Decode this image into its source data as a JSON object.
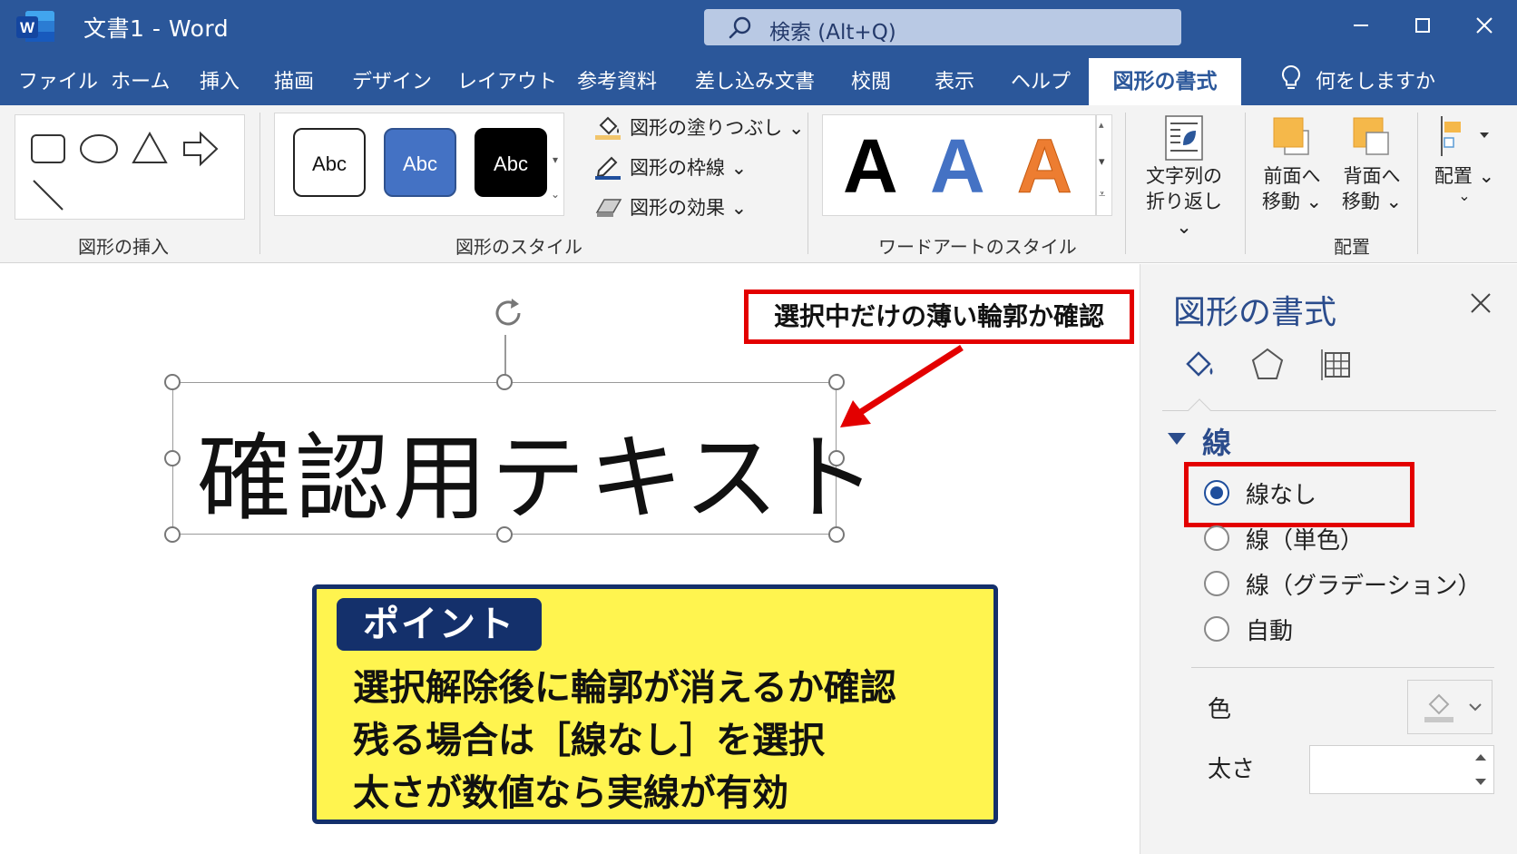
{
  "window": {
    "title": "文書1  -  Word",
    "search_placeholder": "検索 (Alt+Q)"
  },
  "menu": {
    "tabs": [
      "ファイル",
      "ホーム",
      "挿入",
      "描画",
      "デザイン",
      "レイアウト",
      "参考資料",
      "差し込み文書",
      "校閲",
      "表示",
      "ヘルプ"
    ],
    "active_tab": "図形の書式",
    "tell_me": "何をしますか"
  },
  "ribbon": {
    "insert_shapes": {
      "label": "図形の挿入"
    },
    "shape_styles": {
      "label": "図形のスタイル",
      "presets": [
        "Abc",
        "Abc",
        "Abc"
      ],
      "fill": "図形の塗りつぶし ⌄",
      "outline": "図形の枠線 ⌄",
      "effects": "図形の効果 ⌄"
    },
    "wordart": {
      "label": "ワードアートのスタイル",
      "letter": "A"
    },
    "wrap_text": {
      "line1": "文字列の",
      "line2": "折り返し ⌄"
    },
    "bring_forward": {
      "line1": "前面へ",
      "line2": "移動 ⌄"
    },
    "send_backward": {
      "line1": "背面へ",
      "line2": "移動 ⌄"
    },
    "align": {
      "label": "配置 ⌄"
    },
    "arrange_label": "配置"
  },
  "document": {
    "textbox_text": "確認用テキスト",
    "callout": "選択中だけの薄い輪郭か確認",
    "point": {
      "badge": "ポイント",
      "lines": [
        "選択解除後に輪郭が消えるか確認",
        "残る場合は［線なし］を選択",
        "太さが数値なら実線が有効"
      ]
    }
  },
  "pane": {
    "title": "図形の書式",
    "section": "線",
    "options": [
      "線なし",
      "線（単色）",
      "線（グラデーション）",
      "自動"
    ],
    "selected_option": "線なし",
    "color_label": "色",
    "width_label": "太さ",
    "width_value": ""
  },
  "colors": {
    "word_blue": "#2b579a",
    "highlight_red": "#e30000",
    "point_yellow": "#fff44f",
    "point_navy": "#14306b",
    "wordart_black": "#000000",
    "wordart_blue": "#4472c4",
    "wordart_orange": "#ed7d31"
  }
}
